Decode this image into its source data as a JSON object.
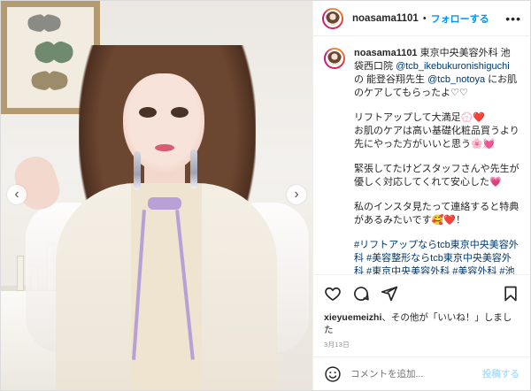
{
  "post": {
    "username": "noasama1101",
    "follow_label": "フォローする",
    "more_icon": "more-icon",
    "caption": {
      "p1_a": "東京中央美容外科 池袋西口院 ",
      "p1_mention1": "@tcb_ikebukuronishiguchi",
      "p1_b": " の 能登谷翔先生 ",
      "p1_mention2": "@tcb_notoya",
      "p1_c": " にお肌のケアしてもらったよ♡♡",
      "p2": "リフトアップして大満足💮❤️",
      "p3": "お肌のケアは高い基礎化粧品買うより先にやった方がいいと思う🌸💓",
      "p4": "緊張してたけどスタッフさんや先生が優しく対応してくれて安心した💗",
      "p5": "私のインスタ見たって連絡すると特典があるみたいです🥰❤️！",
      "hashtags": "#リフトアップならtcb東京中央美容外科 #美容整形ならtcb東京中央美容外科 #東京中央美容外科 #美容外科 #池袋西口 #東京中央美容外科池袋西口院 #tcb #美容クリニック #美容医療"
    },
    "likes": {
      "user": "xieyuemeizhi",
      "rest": "、その他が「いいね！」しました"
    },
    "date": "3月13日",
    "comment_placeholder": "コメントを追加...",
    "post_label": "投稿する"
  },
  "icons": [
    "heart-icon",
    "comment-icon",
    "share-icon",
    "bookmark-icon",
    "emoji-icon",
    "chevron-left-icon",
    "chevron-right-icon"
  ],
  "colors": {
    "link": "#0095f6",
    "mention": "#00376b",
    "muted": "#8e8e8e",
    "post_disabled": "#b2dffc"
  }
}
